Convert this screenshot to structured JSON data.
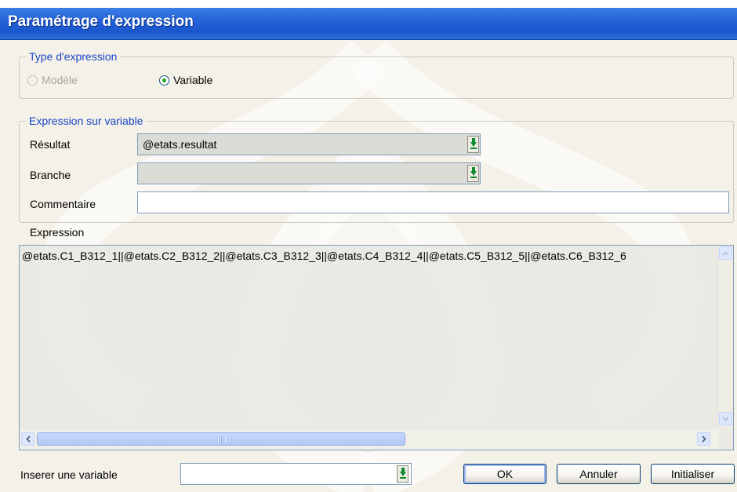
{
  "window": {
    "title": "Paramétrage d'expression"
  },
  "type_group": {
    "legend": "Type d'expression",
    "radio_modele": "Modèle",
    "radio_variable": "Variable",
    "selected": "Variable"
  },
  "variable_group": {
    "legend": "Expression sur variable",
    "resultat_label": "Résultat",
    "resultat_value": "@etats.resultat",
    "branche_label": "Branche",
    "branche_value": "",
    "commentaire_label": "Commentaire",
    "commentaire_value": ""
  },
  "expression": {
    "label": "Expression",
    "text": "@etats.C1_B312_1||@etats.C2_B312_2||@etats.C3_B312_3||@etats.C4_B312_4||@etats.C5_B312_5||@etats.C6_B312_6"
  },
  "footer": {
    "insert_label": "Inserer une variable",
    "insert_value": "",
    "ok": "OK",
    "annuler": "Annuler",
    "initialiser": "Initialiser"
  },
  "colors": {
    "titlebar": "#2463d8",
    "legend": "#1a46c8",
    "dropdown_arrow": "#0e8a2c"
  }
}
